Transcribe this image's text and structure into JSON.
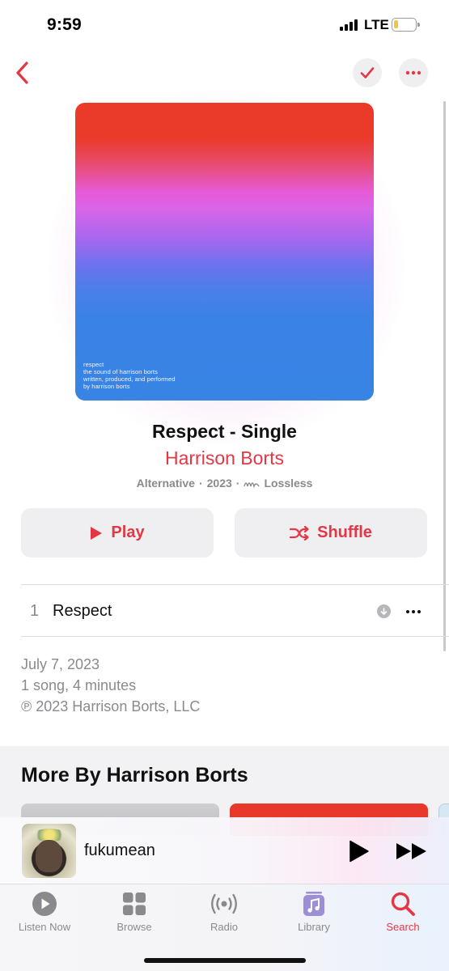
{
  "status_bar": {
    "time": "9:59",
    "network": "LTE",
    "battery_level": 0.2
  },
  "nav": {
    "back_icon": "chevron-left-icon",
    "check_icon": "checkmark-icon",
    "more_icon": "ellipsis-icon"
  },
  "album": {
    "art_caption": [
      "respect",
      "the sound of harrison borts",
      "written, produced, and performed",
      "by harrison borts"
    ],
    "title": "Respect - Single",
    "artist": "Harrison Borts",
    "genre": "Alternative",
    "year": "2023",
    "separator": "·",
    "quality": "Lossless"
  },
  "actions": {
    "play_label": "Play",
    "shuffle_label": "Shuffle"
  },
  "tracks": [
    {
      "number": "1",
      "title": "Respect"
    }
  ],
  "info": {
    "release_date": "July 7, 2023",
    "summary": "1 song, 4 minutes",
    "copyright": "℗ 2023 Harrison Borts, LLC"
  },
  "more_by": {
    "title": "More By Harrison Borts"
  },
  "now_playing": {
    "title": "fukumean"
  },
  "tab_bar": {
    "tabs": [
      {
        "label": "Listen Now",
        "icon": "play-circle-icon"
      },
      {
        "label": "Browse",
        "icon": "grid-icon"
      },
      {
        "label": "Radio",
        "icon": "radio-waves-icon"
      },
      {
        "label": "Library",
        "icon": "music-note-library-icon"
      },
      {
        "label": "Search",
        "icon": "search-icon"
      }
    ],
    "active": "Search"
  },
  "colors": {
    "accent": "#e43745",
    "secondary_text": "#8a8a8e",
    "button_bg": "#efeff1"
  }
}
